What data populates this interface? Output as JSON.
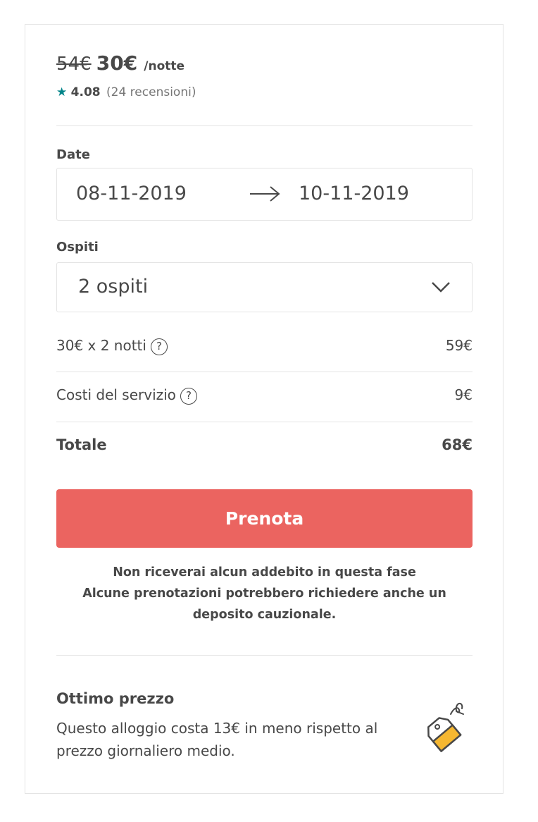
{
  "listing": {
    "old_price": "54€",
    "new_price": "30€",
    "per_night": "/notte",
    "rating": "4.08",
    "reviews": "(24 recensioni)"
  },
  "dates": {
    "label": "Date",
    "check_in": "08-11-2019",
    "check_out": "10-11-2019"
  },
  "guests": {
    "label": "Ospiti",
    "selected": "2 ospiti"
  },
  "breakdown": {
    "nights_label": "30€ x 2 notti",
    "nights_value": "59€",
    "service_label": "Costi del servizio",
    "service_value": "9€",
    "total_label": "Totale",
    "total_value": "68€",
    "help_glyph": "?"
  },
  "book_button": {
    "label": "Prenota"
  },
  "notice": {
    "line1": "Non riceverai alcun addebito in questa fase",
    "line2": "Alcune prenotazioni potrebbero richiedere anche un",
    "line3": "deposito cauzionale."
  },
  "deal": {
    "title": "Ottimo prezzo",
    "description": "Questo alloggio costa 13€ in meno rispetto al prezzo giornaliero medio."
  },
  "icons": {
    "star": "star-icon",
    "arrow": "arrow-right-icon",
    "chevron": "chevron-down-icon",
    "help": "question-circle-icon",
    "tag": "price-tag-icon"
  },
  "colors": {
    "accent": "#eb6460",
    "rating_star": "#008489",
    "text": "#484848",
    "muted": "#767676",
    "border": "#e4e4e4",
    "tag_fill": "#f5b731"
  }
}
